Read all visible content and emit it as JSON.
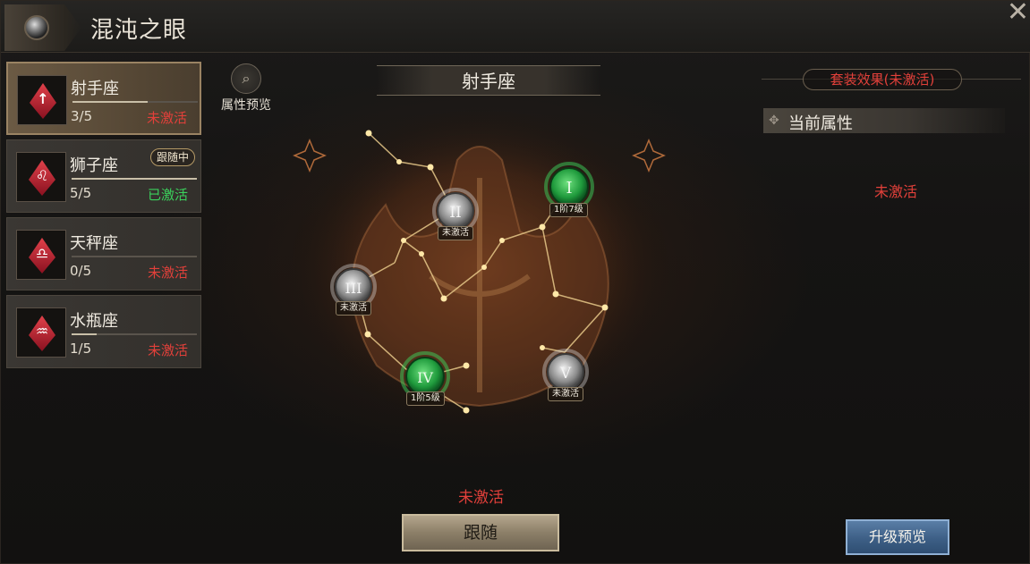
{
  "header": {
    "title": "混沌之眼"
  },
  "close": {
    "symbol": "✕"
  },
  "signs": [
    {
      "name": "射手座",
      "progress": "3/5",
      "progress_value": 0.6,
      "status": "未激活",
      "active": false,
      "selected": true,
      "following": false,
      "glyph": "↑"
    },
    {
      "name": "狮子座",
      "progress": "5/5",
      "progress_value": 1.0,
      "status": "已激活",
      "active": true,
      "selected": false,
      "following": true,
      "glyph": "♌"
    },
    {
      "name": "天秤座",
      "progress": "0/5",
      "progress_value": 0.0,
      "status": "未激活",
      "active": false,
      "selected": false,
      "following": false,
      "glyph": "♎"
    },
    {
      "name": "水瓶座",
      "progress": "1/5",
      "progress_value": 0.2,
      "status": "未激活",
      "active": false,
      "selected": false,
      "following": false,
      "glyph": "♒"
    }
  ],
  "follow_badge": "跟随中",
  "attr_preview": {
    "label": "属性预览",
    "icon": "scroll-search-icon"
  },
  "constellation": {
    "title": "射手座",
    "nodes": [
      {
        "numeral": "I",
        "label": "1阶7级",
        "active": true
      },
      {
        "numeral": "II",
        "label": "未激活",
        "active": false
      },
      {
        "numeral": "III",
        "label": "未激活",
        "active": false
      },
      {
        "numeral": "IV",
        "label": "1阶5级",
        "active": true
      },
      {
        "numeral": "V",
        "label": "未激活",
        "active": false
      }
    ]
  },
  "right_panel": {
    "set_effect": "套装效果(未激活)",
    "current_attr_title": "当前属性",
    "status": "未激活"
  },
  "bottom": {
    "status": "未激活",
    "follow_button": "跟随",
    "upgrade_button": "升级预览"
  },
  "colors": {
    "inactive_red": "#e2403a",
    "active_green": "#3bd15c",
    "node_green": "#1f9a3c",
    "node_gray": "#8a8a8a"
  }
}
